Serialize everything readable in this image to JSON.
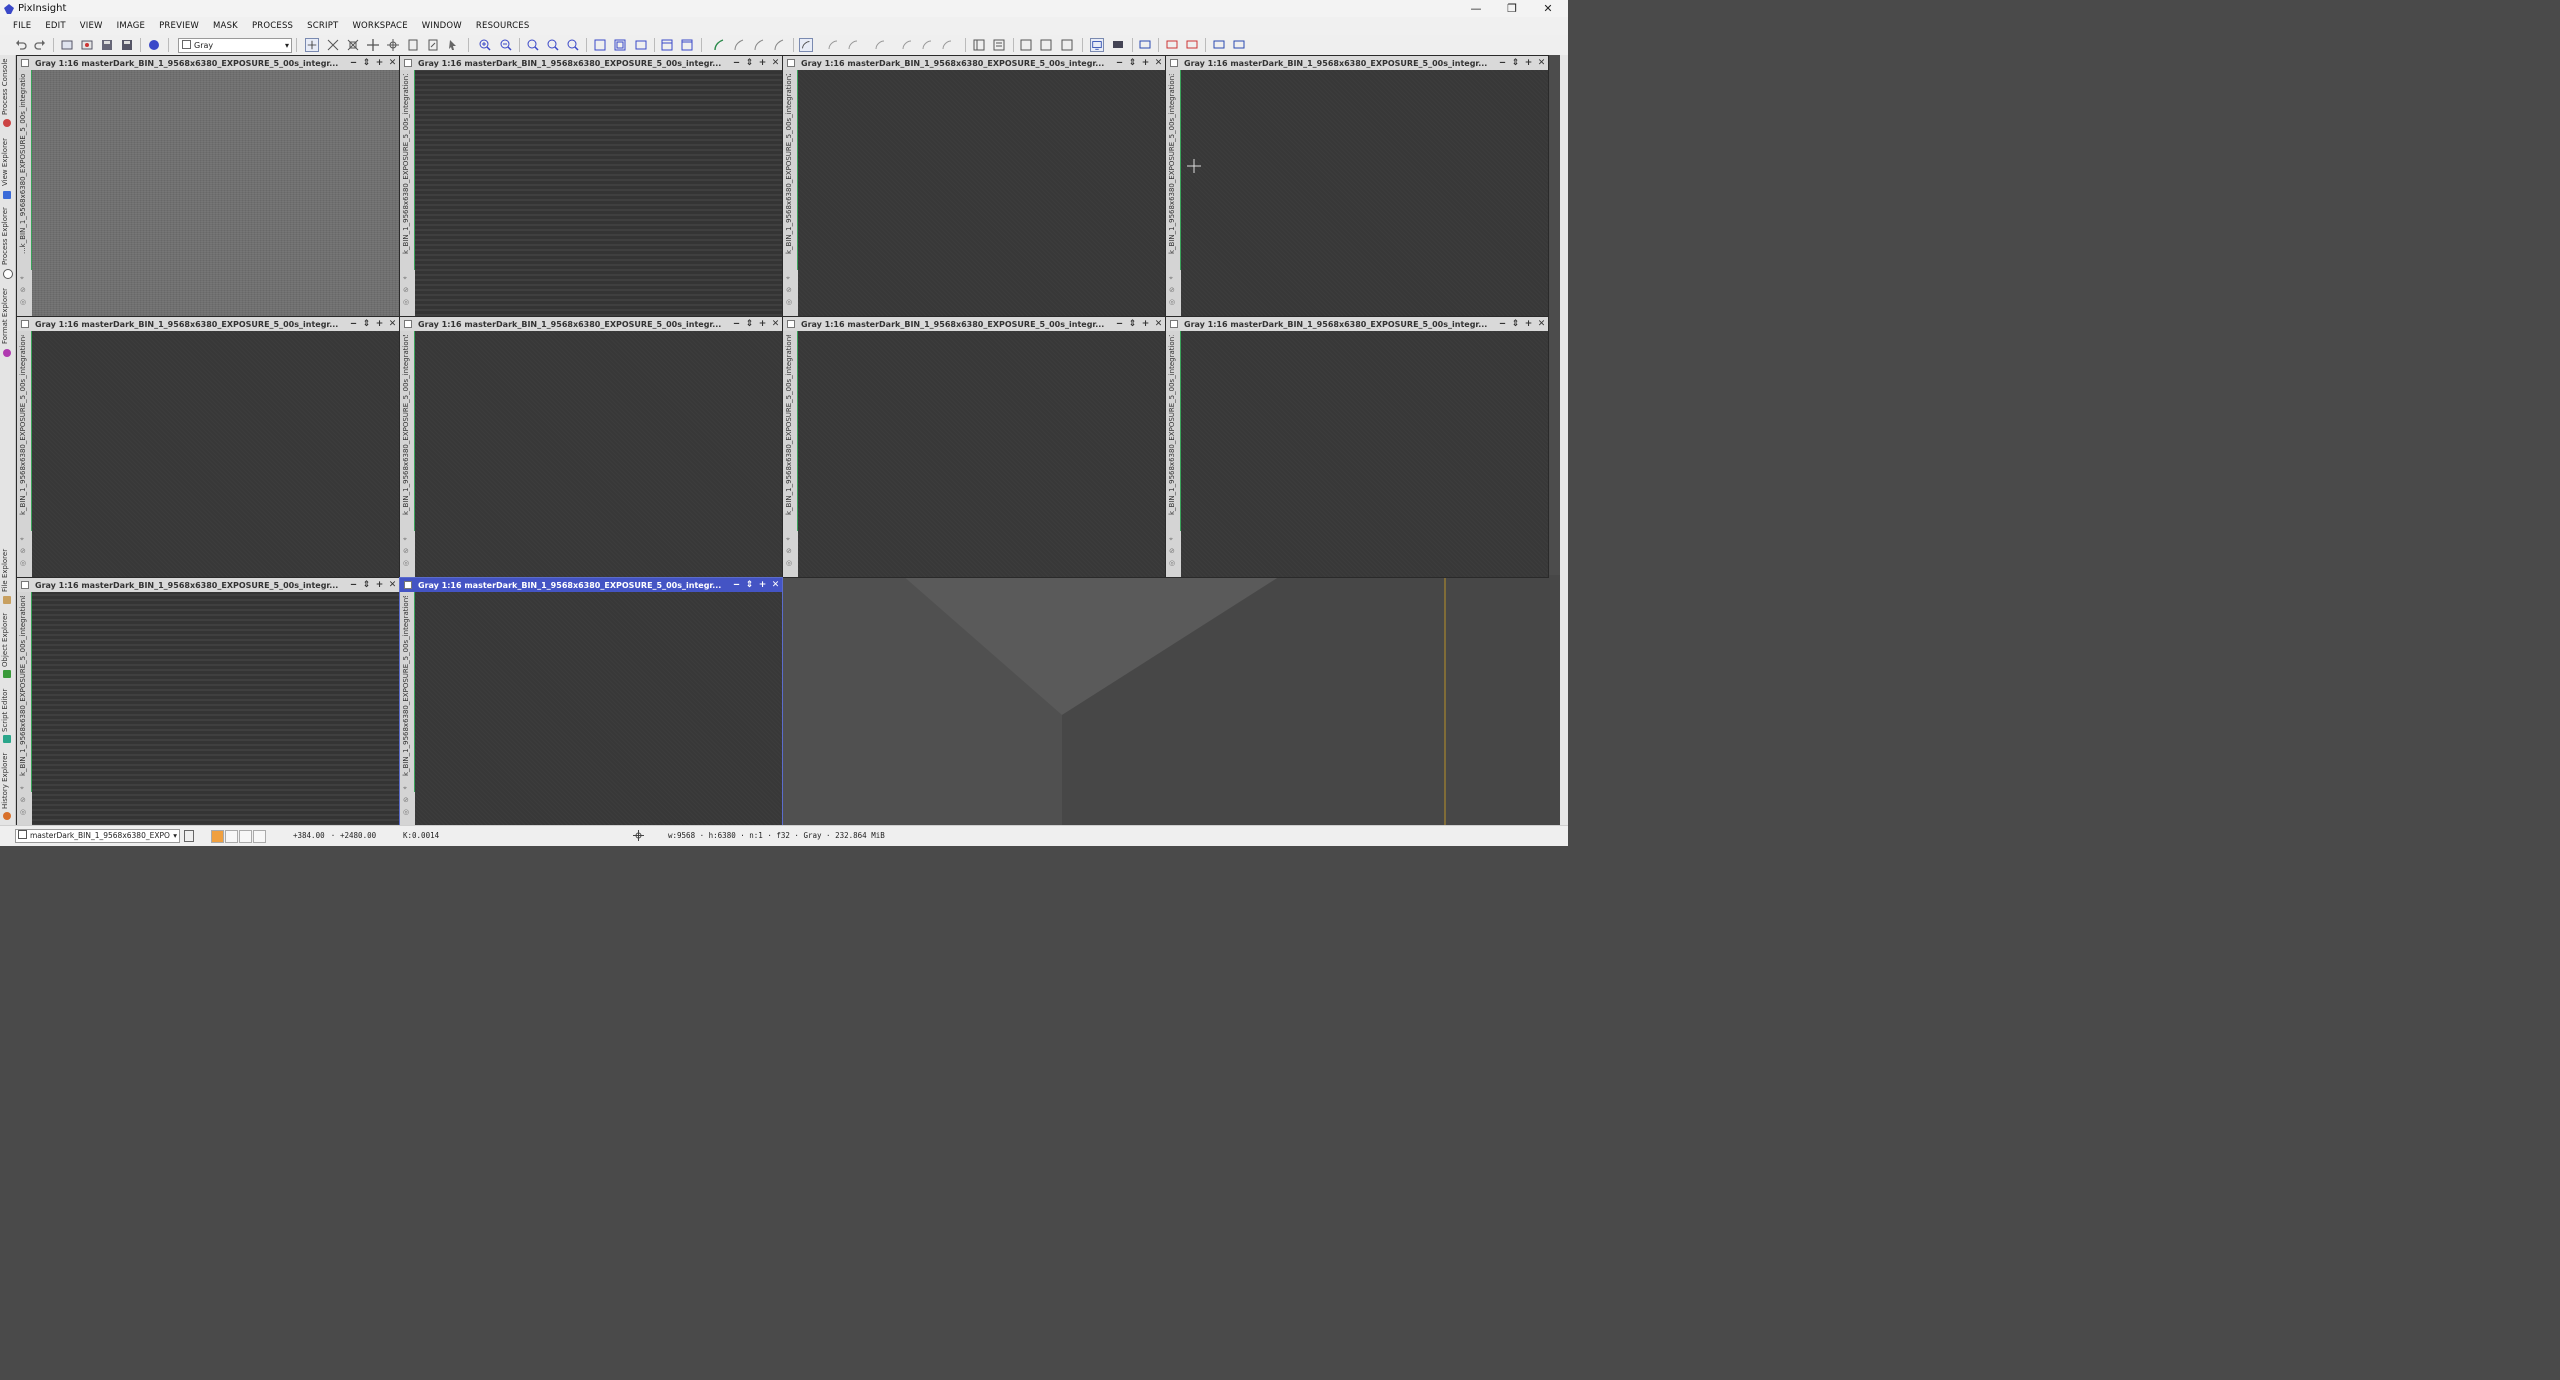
{
  "app": {
    "title": "PixInsight",
    "logo_color": "#3a48c8"
  },
  "window_controls": {
    "minimize": "—",
    "restore": "❐",
    "close": "✕"
  },
  "menu": [
    "FILE",
    "EDIT",
    "VIEW",
    "IMAGE",
    "PREVIEW",
    "MASK",
    "PROCESS",
    "SCRIPT",
    "WORKSPACE",
    "WINDOW",
    "RESOURCES"
  ],
  "toolbar": {
    "color_mode": "Gray"
  },
  "side_tabs": [
    "Process Console",
    "View Explorer",
    "Process Explorer",
    "Format Explorer",
    "File Explorer",
    "Object Explorer",
    "Script Editor",
    "History Explorer"
  ],
  "image_windows": [
    {
      "title": "Gray 1:16 masterDark_BIN_1_9568x6380_EXPOSURE_5_00s_integr...",
      "view_id": "...k_BIN_1_9568x6380_EXPOSURE_5_00s_integration",
      "noise": "a"
    },
    {
      "title": "Gray 1:16 masterDark_BIN_1_9568x6380_EXPOSURE_5_00s_integr...",
      "view_id": "k_BIN_1_9568x6380_EXPOSURE_5_00s_integration1",
      "noise": "b"
    },
    {
      "title": "Gray 1:16 masterDark_BIN_1_9568x6380_EXPOSURE_5_00s_integr...",
      "view_id": "k_BIN_1_9568x6380_EXPOSURE_5_00s_integration2",
      "noise": "c"
    },
    {
      "title": "Gray 1:16 masterDark_BIN_1_9568x6380_EXPOSURE_5_00s_integr...",
      "view_id": "k_BIN_1_9568x6380_EXPOSURE_5_00s_integration3",
      "noise": "c"
    },
    {
      "title": "Gray 1:16 masterDark_BIN_1_9568x6380_EXPOSURE_5_00s_integr...",
      "view_id": "k_BIN_1_9568x6380_EXPOSURE_5_00s_integration4",
      "noise": "c"
    },
    {
      "title": "Gray 1:16 masterDark_BIN_1_9568x6380_EXPOSURE_5_00s_integr...",
      "view_id": "k_BIN_1_9568x6380_EXPOSURE_5_00s_integration5",
      "noise": "c"
    },
    {
      "title": "Gray 1:16 masterDark_BIN_1_9568x6380_EXPOSURE_5_00s_integr...",
      "view_id": "k_BIN_1_9568x6380_EXPOSURE_5_00s_integration6",
      "noise": "c"
    },
    {
      "title": "Gray 1:16 masterDark_BIN_1_9568x6380_EXPOSURE_5_00s_integr...",
      "view_id": "k_BIN_1_9568x6380_EXPOSURE_5_00s_integration7",
      "noise": "c"
    },
    {
      "title": "Gray 1:16 masterDark_BIN_1_9568x6380_EXPOSURE_5_00s_integr...",
      "view_id": "k_BIN_1_9568x6380_EXPOSURE_5_00s_integration8",
      "noise": "b"
    },
    {
      "title": "Gray 1:16 masterDark_BIN_1_9568x6380_EXPOSURE_5_00s_integr...",
      "view_id": "k_BIN_1_9568x6380_EXPOSURE_5_00s_integration9",
      "noise": "c",
      "active": true
    }
  ],
  "title_buttons": {
    "minimize": "‒",
    "shade": "⇕",
    "maximize": "+",
    "close": "✕"
  },
  "status": {
    "view_select": "masterDark_BIN_1_9568x6380_EXPO",
    "x": "+384.00",
    "y": "+2480.00",
    "k": "K:0.0014",
    "info": "w:9568 · h:6380 · n:1 · f32 · Gray · 232.864 MiB"
  }
}
